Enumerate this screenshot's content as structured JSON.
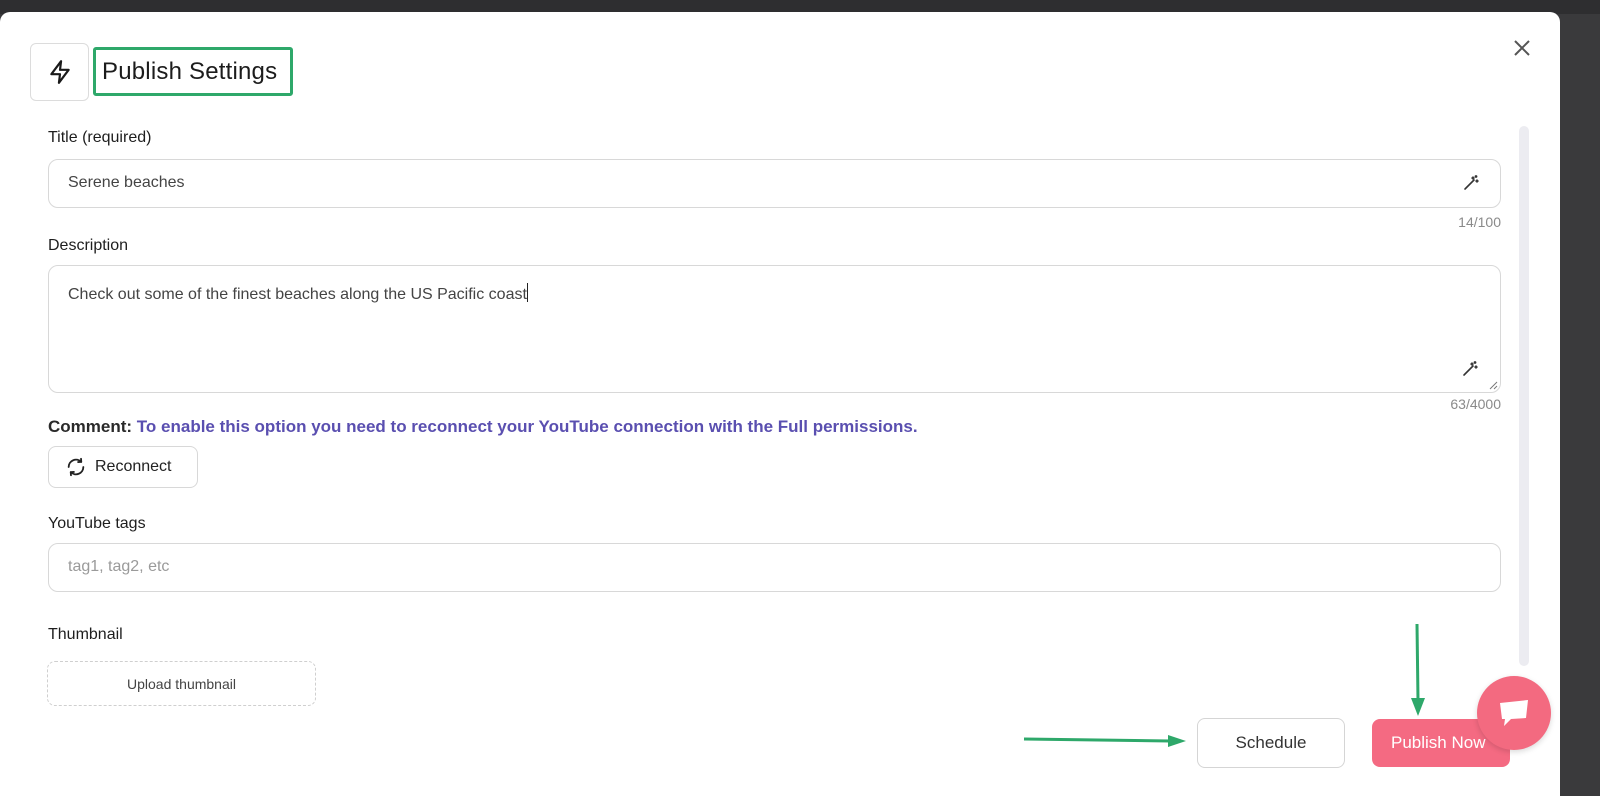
{
  "header": {
    "title": "Publish Settings",
    "icon": "lightning-icon",
    "close_icon": "close-icon"
  },
  "fields": {
    "title": {
      "label": "Title (required)",
      "value": "Serene beaches",
      "counter": "14/100",
      "assist_icon": "magic-wand-icon"
    },
    "description": {
      "label": "Description",
      "value": "Check out some of the finest beaches along the US Pacific coast",
      "counter": "63/4000",
      "assist_icon": "magic-wand-icon"
    },
    "comment": {
      "label": "Comment:",
      "message": "To enable this option you need to reconnect your YouTube connection with the Full permissions.",
      "reconnect_label": "Reconnect",
      "reconnect_icon": "refresh-icon"
    },
    "tags": {
      "label": "YouTube tags",
      "placeholder": "tag1, tag2, etc"
    },
    "thumbnail": {
      "label": "Thumbnail",
      "upload_label": "Upload thumbnail"
    }
  },
  "footer": {
    "schedule_label": "Schedule",
    "publish_label": "Publish Now",
    "chat_icon": "chat-icon"
  },
  "colors": {
    "accent": "#f46a82",
    "comment_message": "#5a4fb0",
    "annotation_green": "#2ea86a"
  }
}
